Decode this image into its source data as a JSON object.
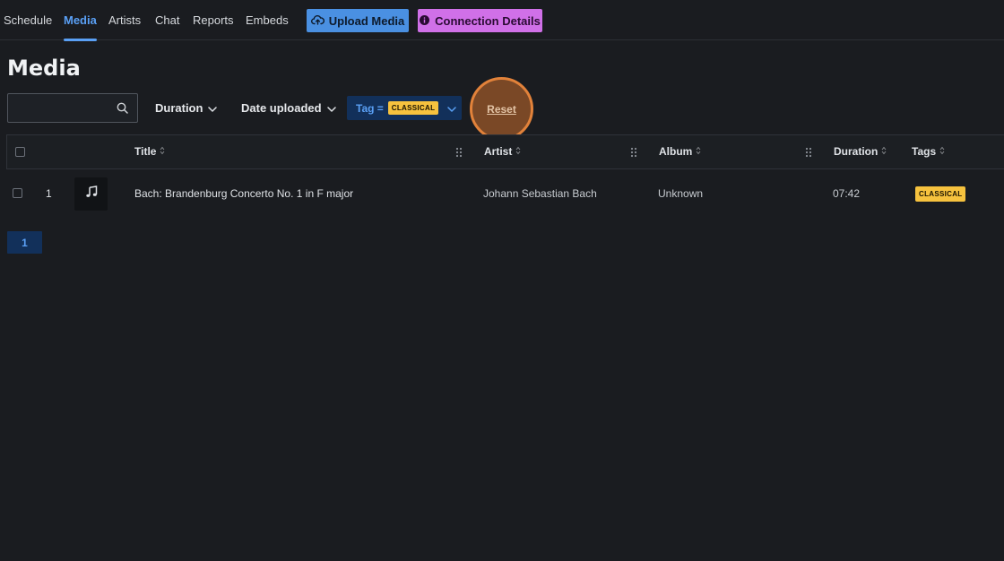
{
  "nav": {
    "items": [
      {
        "label": "Schedule",
        "active": false
      },
      {
        "label": "Media",
        "active": true
      },
      {
        "label": "Artists",
        "active": false
      },
      {
        "label": "Chat",
        "active": false
      },
      {
        "label": "Reports",
        "active": false
      },
      {
        "label": "Embeds",
        "active": false
      }
    ],
    "upload_label": "Upload Media",
    "connection_label": "Connection Details"
  },
  "page": {
    "title": "Media"
  },
  "filters": {
    "search_placeholder": "",
    "duration_label": "Duration",
    "date_label": "Date uploaded",
    "tag_prefix": "Tag =",
    "tag_value": "CLASSICAL",
    "reset_label": "Reset"
  },
  "table": {
    "columns": [
      "Title",
      "Artist",
      "Album",
      "Duration",
      "Tags"
    ],
    "rows": [
      {
        "index": "1",
        "title": "Bach: Brandenburg Concerto No. 1 in F major",
        "artist": "Johann Sebastian Bach",
        "album": "Unknown",
        "duration": "07:42",
        "tag": "CLASSICAL"
      }
    ]
  },
  "pagination": {
    "current": "1"
  },
  "colors": {
    "background": "#1a1c20",
    "accent_blue": "#4a90e2",
    "accent_purple": "#d070e8",
    "tag_yellow": "#f6c23e",
    "highlight_orange": "#e2823a"
  },
  "icons": {
    "upload": "cloud-upload-icon",
    "connection": "info-circle-icon",
    "search": "search-icon",
    "chevron": "chevron-down-icon",
    "sort": "sort-icon",
    "drag": "drag-handle-icon",
    "music": "music-note-icon"
  }
}
